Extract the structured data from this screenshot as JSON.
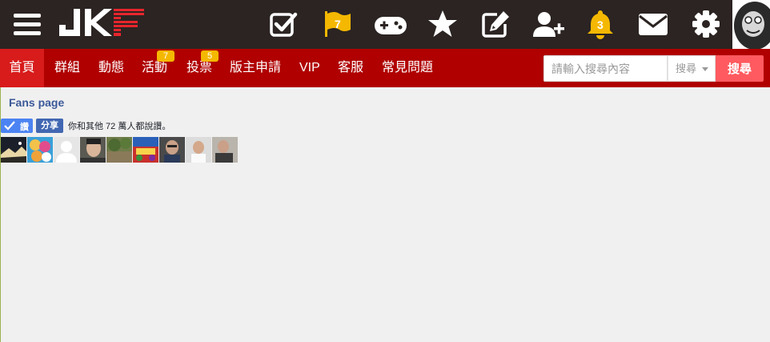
{
  "header": {
    "logo_text": "JKF",
    "icons": [
      {
        "name": "checkbox-icon"
      },
      {
        "name": "flag-icon",
        "badge": "7"
      },
      {
        "name": "gamepad-icon"
      },
      {
        "name": "star-icon"
      },
      {
        "name": "edit-icon"
      },
      {
        "name": "add-user-icon"
      },
      {
        "name": "bell-icon",
        "badge": "3"
      },
      {
        "name": "mail-icon"
      },
      {
        "name": "gear-icon"
      }
    ],
    "colors": {
      "bar": "#2b2422",
      "flag": "#f5b800",
      "bell": "#f5b800"
    }
  },
  "nav": {
    "items": [
      {
        "label": "首頁",
        "active": true
      },
      {
        "label": "群組"
      },
      {
        "label": "動態"
      },
      {
        "label": "活動",
        "badge": "7"
      },
      {
        "label": "投票",
        "badge": "5"
      },
      {
        "label": "版主申請"
      },
      {
        "label": "VIP"
      },
      {
        "label": "客服"
      },
      {
        "label": "常見問題"
      }
    ],
    "colors": {
      "bar": "#b00000",
      "active": "#d81b1b",
      "badge": "#f5b800"
    }
  },
  "search": {
    "placeholder": "請輸入搜尋內容",
    "select_value": "搜尋",
    "button_label": "搜尋"
  },
  "fanpage": {
    "title": "Fans page",
    "like_label": "讚",
    "share_label": "分享",
    "social_text": "你和其他 72 萬人都說讚。"
  }
}
